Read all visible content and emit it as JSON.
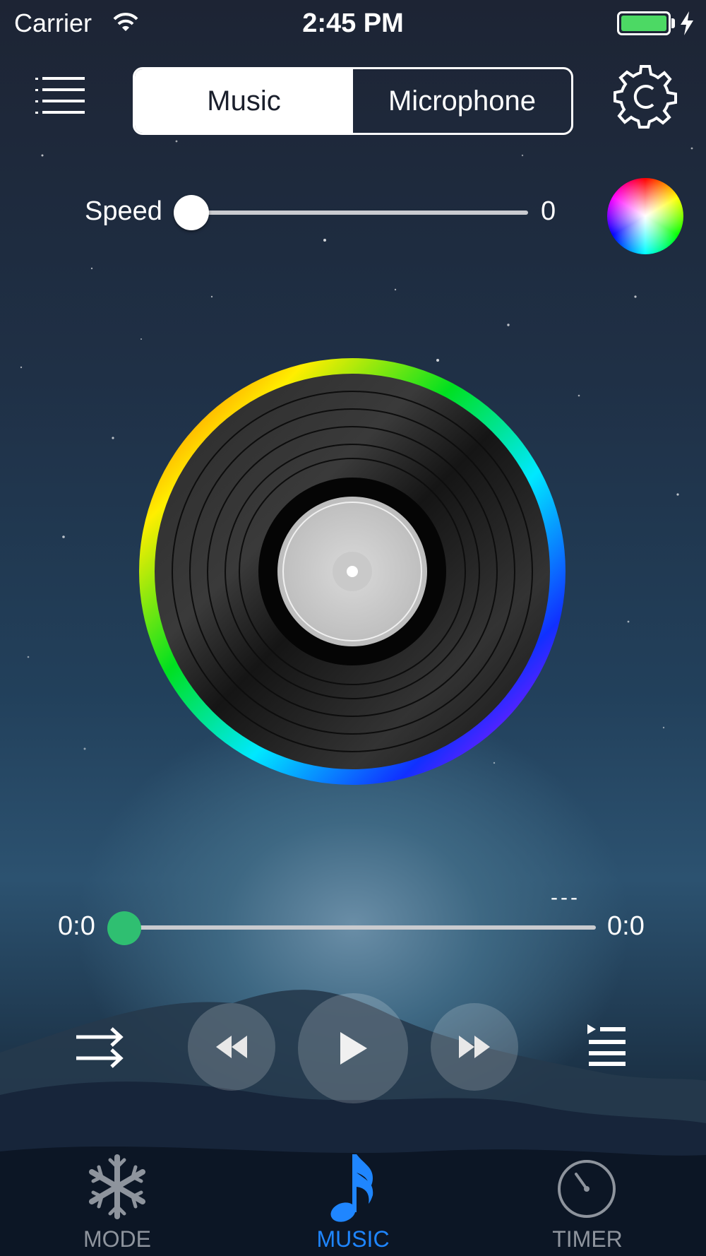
{
  "status_bar": {
    "carrier": "Carrier",
    "time": "2:45 PM",
    "battery_level": 1.0,
    "battery_color": "#4cd964"
  },
  "header": {
    "menu_icon": "list-menu-icon",
    "segment": {
      "options": [
        "Music",
        "Microphone"
      ],
      "selected": "Music"
    },
    "settings_icon": "gear-icon"
  },
  "speed": {
    "label": "Speed",
    "value": "0",
    "slider_fraction": 0.0
  },
  "color_picker_icon": "color-wheel-icon",
  "record_icon": "vinyl-record-icon",
  "playback": {
    "current_time": "0:0",
    "total_time": "0:0",
    "track_title": "---",
    "progress_fraction": 0.0,
    "thumb_color": "#2fbf71"
  },
  "controls": {
    "shuffle_icon": "shuffle-icon",
    "prev_icon": "rewind-icon",
    "play_icon": "play-icon",
    "next_icon": "fast-forward-icon",
    "playlist_icon": "playlist-icon"
  },
  "tabs": [
    {
      "label": "MODE",
      "icon": "snowflake-icon",
      "active": false
    },
    {
      "label": "MUSIC",
      "icon": "music-note-icon",
      "active": true
    },
    {
      "label": "TIMER",
      "icon": "timer-icon",
      "active": false
    }
  ],
  "accent_color": "#1f86ff"
}
